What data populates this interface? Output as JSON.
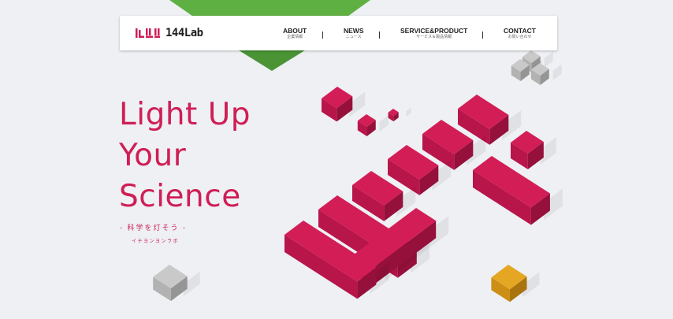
{
  "brand": {
    "logo_text": "144Lab",
    "accent": "#cf1e55"
  },
  "nav": [
    {
      "en": "ABOUT",
      "ja": "企業情報"
    },
    {
      "en": "NEWS",
      "ja": "ニュース"
    },
    {
      "en": "SERVICE&PRODUCT",
      "ja": "サービス＆製品情報"
    },
    {
      "en": "CONTACT",
      "ja": "お問い合わせ"
    }
  ],
  "hero": {
    "title_lines": [
      "Light Up",
      "Your",
      "Science"
    ],
    "tagline": "- 科学を灯そう -",
    "kana": "イチヨンヨンラボ"
  },
  "colors": {
    "green": "#5fb043",
    "crimson": "#cf1e55",
    "gray": "#b7b7b7",
    "gold": "#e3a21a"
  }
}
